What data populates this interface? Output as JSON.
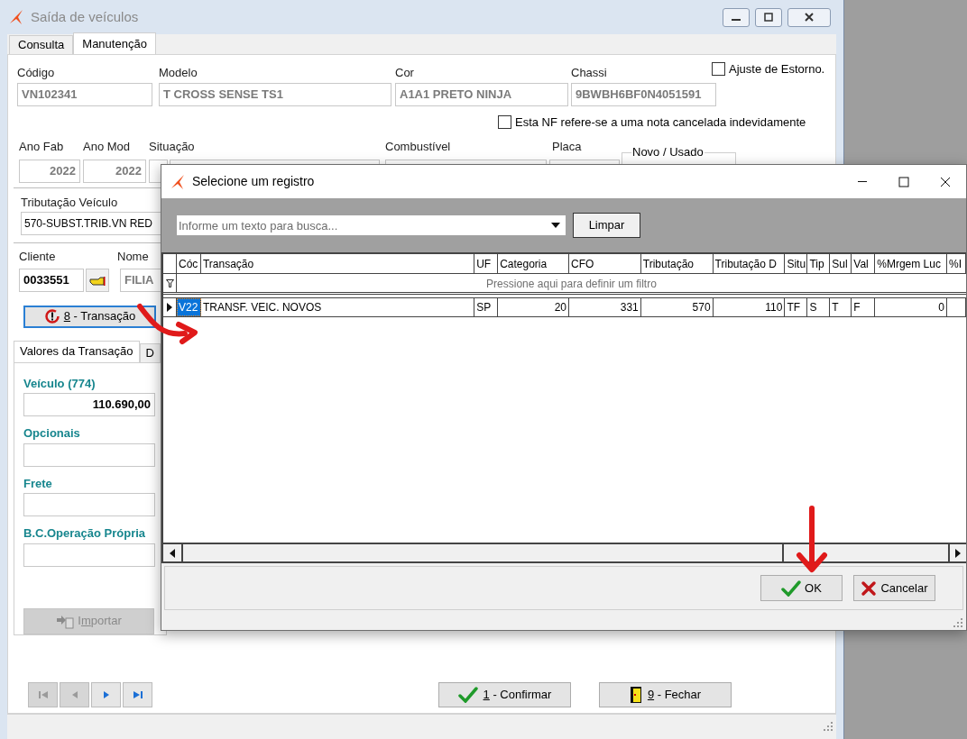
{
  "main_window": {
    "title": "Saída de veículos"
  },
  "tabs": [
    {
      "label": "Consulta",
      "selected": false
    },
    {
      "label": "Manutenção",
      "selected": true
    }
  ],
  "top_fields": [
    {
      "label": "Código",
      "value": "VN102341"
    },
    {
      "label": "Modelo",
      "value": "T CROSS SENSE TS1"
    },
    {
      "label": "Cor",
      "value": "A1A1 PRETO NINJA"
    },
    {
      "label": "Chassi",
      "value": "9BWBH6BF0N4051591"
    }
  ],
  "checkboxes": [
    {
      "label": "Ajuste  de Estorno.",
      "checked": false
    },
    {
      "label": "Esta NF refere-se a uma nota cancelada indevidamente",
      "checked": false
    }
  ],
  "second_fields": [
    {
      "label": "Ano Fab",
      "value": "2022"
    },
    {
      "label": "Ano Mod",
      "value": "2022"
    },
    {
      "label": "Situação"
    },
    {
      "label": "Combustível"
    },
    {
      "label": "Placa"
    }
  ],
  "novo_usado": {
    "label": "Novo / Usado"
  },
  "tributacao": {
    "label": "Tributação Veículo",
    "value": "570-SUBST.TRIB.VN RED"
  },
  "cliente": {
    "label": "Cliente",
    "value": "0033551"
  },
  "nome": {
    "label": "Nome",
    "value": "FILIA"
  },
  "transacao_button": {
    "hotkey": "8",
    "label": " - Transação",
    "focused": true
  },
  "value_tabs": [
    {
      "label": "Valores da Transação",
      "selected": true
    },
    {
      "label": "D",
      "selected": false
    }
  ],
  "values": [
    {
      "label": "Veículo (774)",
      "value": "110.690,00"
    },
    {
      "label": "Opcionais"
    },
    {
      "label": "Frete"
    },
    {
      "label": "B.C.Operação Própria"
    }
  ],
  "import_button": {
    "before": "I",
    "hotkey": "m",
    "after": "portar",
    "disabled": true
  },
  "nav_buttons": [
    {
      "kind": "first",
      "disabled": true
    },
    {
      "kind": "prev",
      "disabled": true
    },
    {
      "kind": "next",
      "disabled": false
    },
    {
      "kind": "last",
      "disabled": false
    }
  ],
  "actions": [
    {
      "kind": "confirm",
      "hotkey": "1",
      "label": " - Confirmar"
    },
    {
      "kind": "close",
      "hotkey": "9",
      "label": " - Fechar"
    }
  ],
  "dialog": {
    "title": "Selecione um registro",
    "search": {
      "placeholder": "Informe um texto para busca..."
    },
    "clear_button": "Limpar",
    "columns": [
      "Cóc",
      "Transação",
      "UF",
      "Categoria",
      "CFO",
      "Tributação",
      "Tributação D",
      "Situ",
      "Tip",
      "Sul",
      "Val",
      "%Mrgem Luc",
      "%I"
    ],
    "filter_hint": "Pressione aqui para definir um filtro",
    "rows": [
      {
        "selected": true,
        "cells": [
          "V22",
          "TRANSF. VEIC. NOVOS",
          "SP",
          "20",
          "331",
          "570",
          "110",
          "TF",
          "S",
          "T",
          "F",
          "0",
          ""
        ]
      }
    ],
    "buttons": [
      {
        "kind": "ok",
        "label": "OK"
      },
      {
        "kind": "cancel",
        "label": "Cancelar"
      }
    ]
  }
}
